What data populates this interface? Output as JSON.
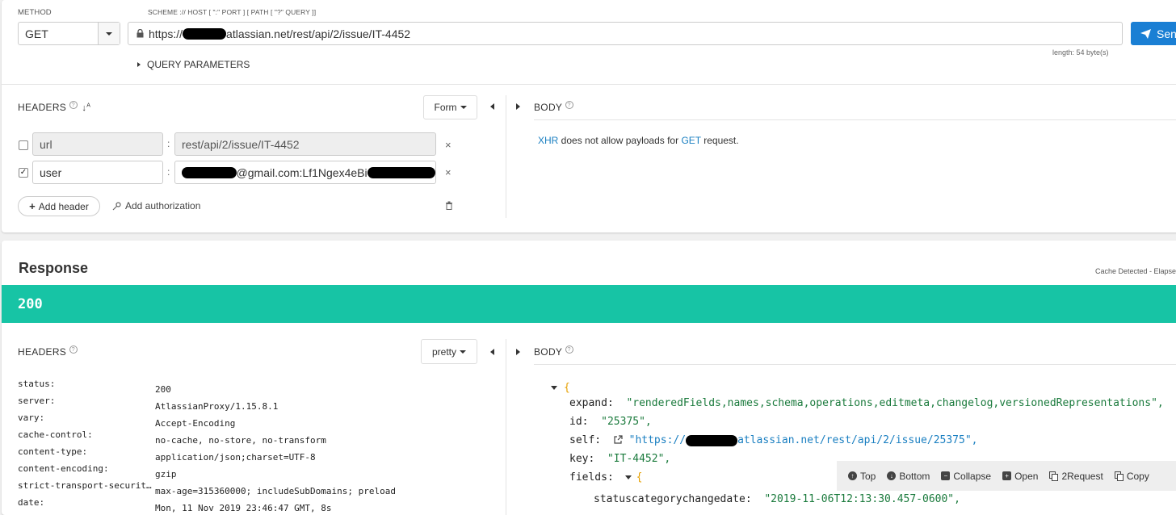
{
  "request": {
    "method_label": "METHOD",
    "url_label": "SCHEME :// HOST [ \":\" PORT ] [ PATH [ \"?\" QUERY ]]",
    "method": "GET",
    "url_prefix": "https://",
    "url_suffix": "atlassian.net/rest/api/2/issue/IT-4452",
    "send_label": "Sen",
    "length": "length: 54 byte(s)",
    "query_params_label": "QUERY PARAMETERS",
    "headers": {
      "title": "HEADERS",
      "mode": "Form",
      "rows": [
        {
          "checked": false,
          "name": "url",
          "value": "rest/api/2/issue/IT-4452"
        },
        {
          "checked": true,
          "name": "user",
          "value_visible": "@gmail.com:Lf1Ngex4eBi"
        }
      ],
      "add_header": "Add header",
      "add_authorization": "Add authorization"
    },
    "body": {
      "title": "BODY",
      "msg_xhr": "XHR",
      "msg_mid": " does not allow payloads for ",
      "msg_get": "GET",
      "msg_end": " request."
    }
  },
  "response": {
    "title": "Response",
    "cache_note": "Cache Detected - Elapse",
    "status": "200",
    "status_color": "#17c4a5",
    "headers": {
      "title": "HEADERS",
      "mode": "pretty",
      "rows": [
        {
          "k": "status:",
          "v": "200"
        },
        {
          "k": "server:",
          "v": "AtlassianProxy/1.15.8.1"
        },
        {
          "k": "vary:",
          "v": "Accept-Encoding"
        },
        {
          "k": "cache-control:",
          "v": "no-cache, no-store, no-transform"
        },
        {
          "k": "content-type:",
          "v": "application/json;charset=UTF-8"
        },
        {
          "k": "content-encoding:",
          "v": "gzip"
        },
        {
          "k": "strict-transport-securit…",
          "v": "max-age=315360000; includeSubDomains; preload"
        },
        {
          "k": "date:",
          "v": "Mon, 11 Nov 2019 23:46:47 GMT, 8s"
        }
      ]
    },
    "body": {
      "title": "BODY",
      "json": {
        "open_brace": "{",
        "expand_key": "expand:",
        "expand_val": "\"renderedFields,names,schema,operations,editmeta,changelog,versionedRepresentations\",",
        "id_key": "id:",
        "id_val": "\"25375\",",
        "self_key": "self:",
        "self_prefix": "\"https://",
        "self_suffix": "atlassian.net/rest/api/2/issue/25375\",",
        "key_key": "key:",
        "key_val": "\"IT-4452\",",
        "fields_key": "fields:",
        "fields_brace": "{",
        "scd_key": "statuscategorychangedate:",
        "scd_val": "\"2019-11-06T12:13:30.457-0600\","
      }
    },
    "toolbar": {
      "top": "Top",
      "bottom": "Bottom",
      "collapse": "Collapse",
      "open": "Open",
      "to_request": "2Request",
      "copy": "Copy"
    }
  }
}
